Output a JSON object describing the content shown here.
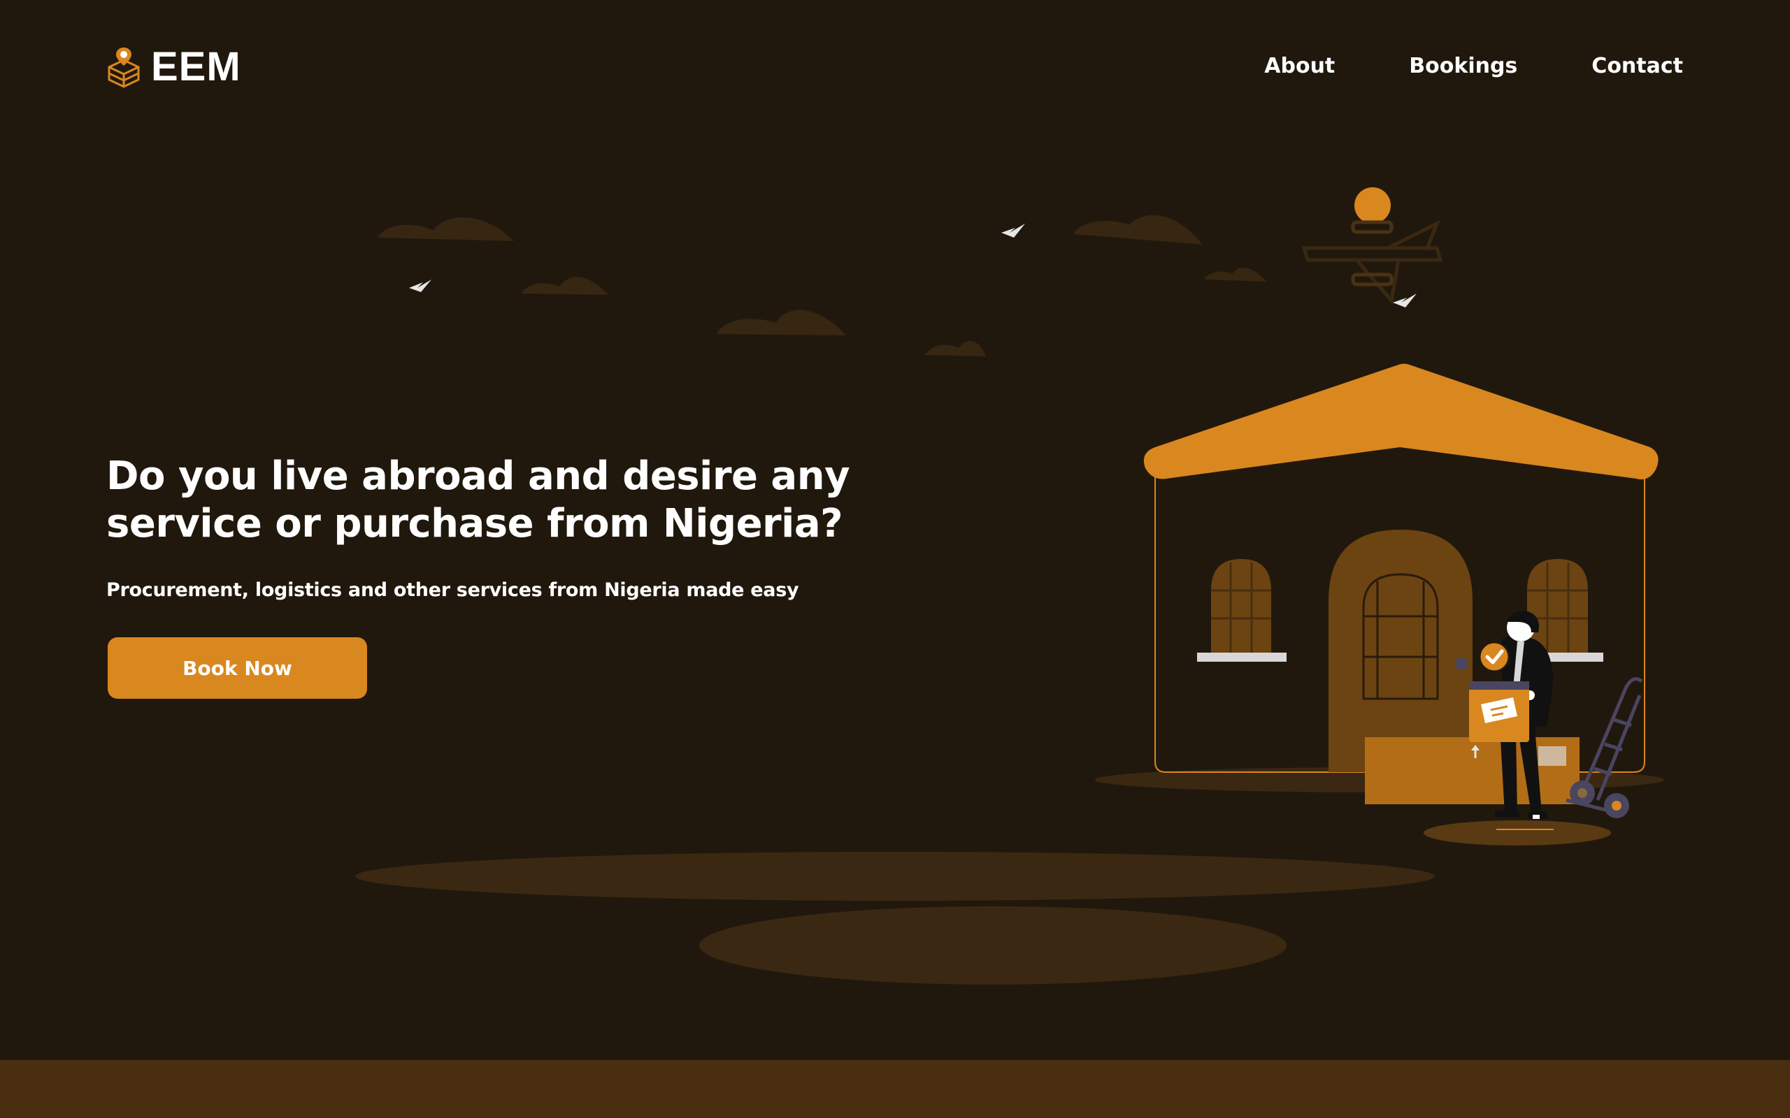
{
  "brand": {
    "name": "EEM",
    "icon": "box-location-pin-icon"
  },
  "nav": {
    "items": [
      {
        "label": "About"
      },
      {
        "label": "Bookings"
      },
      {
        "label": "Contact"
      }
    ]
  },
  "hero": {
    "title": "Do you live abroad and desire any service or purchase from Nigeria?",
    "subtitle": "Procurement, logistics and other services from Nigeria made easy",
    "cta_label": "Book Now"
  },
  "colors": {
    "background": "#21180d",
    "accent": "#d9871f",
    "bottom_strip": "#4a2e10",
    "text": "#ffffff"
  }
}
